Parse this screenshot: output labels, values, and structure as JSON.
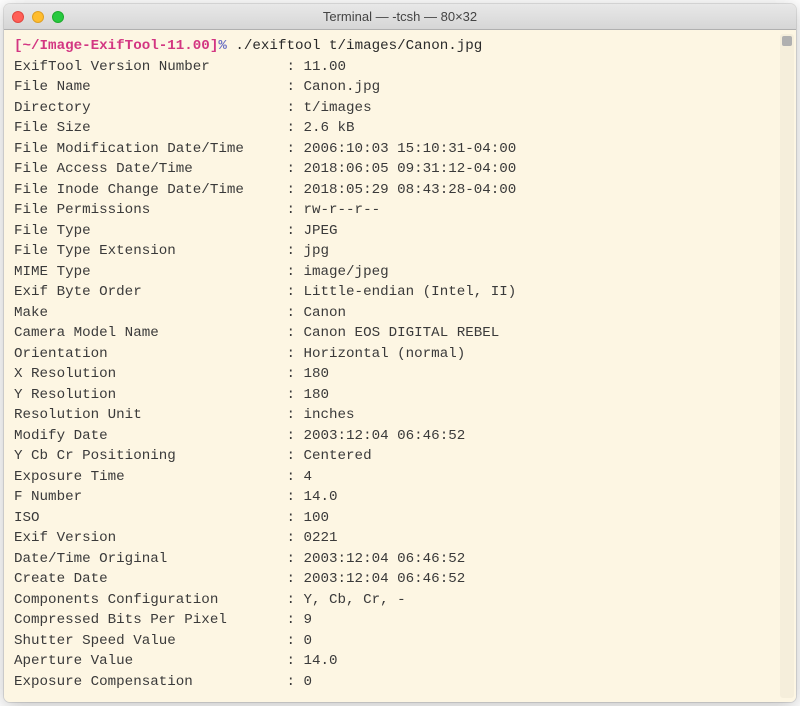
{
  "window": {
    "title": "Terminal — -tcsh — 80×32"
  },
  "prompt": {
    "path": "[~/Image-ExifTool-11.00]",
    "sep": "%",
    "command": " ./exiftool t/images/Canon.jpg"
  },
  "rows": [
    {
      "key": "ExifTool Version Number",
      "val": "11.00"
    },
    {
      "key": "File Name",
      "val": "Canon.jpg"
    },
    {
      "key": "Directory",
      "val": "t/images"
    },
    {
      "key": "File Size",
      "val": "2.6 kB"
    },
    {
      "key": "File Modification Date/Time",
      "val": "2006:10:03 15:10:31-04:00"
    },
    {
      "key": "File Access Date/Time",
      "val": "2018:06:05 09:31:12-04:00"
    },
    {
      "key": "File Inode Change Date/Time",
      "val": "2018:05:29 08:43:28-04:00"
    },
    {
      "key": "File Permissions",
      "val": "rw-r--r--"
    },
    {
      "key": "File Type",
      "val": "JPEG"
    },
    {
      "key": "File Type Extension",
      "val": "jpg"
    },
    {
      "key": "MIME Type",
      "val": "image/jpeg"
    },
    {
      "key": "Exif Byte Order",
      "val": "Little-endian (Intel, II)"
    },
    {
      "key": "Make",
      "val": "Canon"
    },
    {
      "key": "Camera Model Name",
      "val": "Canon EOS DIGITAL REBEL"
    },
    {
      "key": "Orientation",
      "val": "Horizontal (normal)"
    },
    {
      "key": "X Resolution",
      "val": "180"
    },
    {
      "key": "Y Resolution",
      "val": "180"
    },
    {
      "key": "Resolution Unit",
      "val": "inches"
    },
    {
      "key": "Modify Date",
      "val": "2003:12:04 06:46:52"
    },
    {
      "key": "Y Cb Cr Positioning",
      "val": "Centered"
    },
    {
      "key": "Exposure Time",
      "val": "4"
    },
    {
      "key": "F Number",
      "val": "14.0"
    },
    {
      "key": "ISO",
      "val": "100"
    },
    {
      "key": "Exif Version",
      "val": "0221"
    },
    {
      "key": "Date/Time Original",
      "val": "2003:12:04 06:46:52"
    },
    {
      "key": "Create Date",
      "val": "2003:12:04 06:46:52"
    },
    {
      "key": "Components Configuration",
      "val": "Y, Cb, Cr, -"
    },
    {
      "key": "Compressed Bits Per Pixel",
      "val": "9"
    },
    {
      "key": "Shutter Speed Value",
      "val": "0"
    },
    {
      "key": "Aperture Value",
      "val": "14.0"
    },
    {
      "key": "Exposure Compensation",
      "val": "0"
    }
  ]
}
